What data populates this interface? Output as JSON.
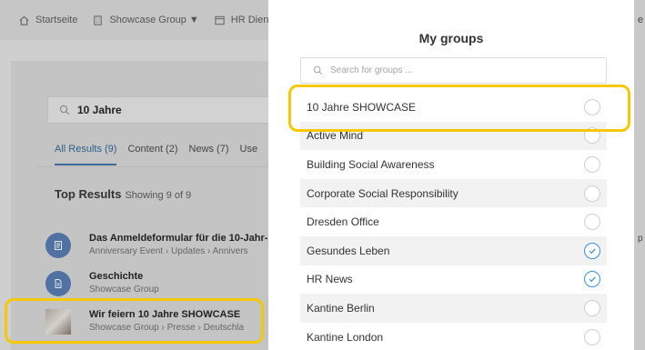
{
  "nav": {
    "home": "Startseite",
    "group": "Showcase Group ▼",
    "hr": "HR Dien",
    "right_edge": "e"
  },
  "search": {
    "query": "10 Jahre"
  },
  "tabs": [
    {
      "label": "All Results (9)"
    },
    {
      "label": "Content (2)"
    },
    {
      "label": "News (7)"
    },
    {
      "label": "Use"
    }
  ],
  "top_results": {
    "title": "Top Results",
    "subtitle": "Showing 9 of 9"
  },
  "results": [
    {
      "title": "Das Anmeldeformular für die 10-Jahr-F",
      "meta": "Anniversary Event  ›  Updates  ›  Annivers"
    },
    {
      "title": "Geschichte",
      "meta": "Showcase Group"
    },
    {
      "title": "Wir feiern 10 Jahre SHOWCASE",
      "meta": "Showcase Group  ›  Presse  ›  Deutschla"
    }
  ],
  "modal": {
    "title": "My groups",
    "search_placeholder": "Search for groups ...",
    "groups": [
      {
        "label": "10 Jahre SHOWCASE",
        "checked": false
      },
      {
        "label": "Active Mind",
        "checked": false
      },
      {
        "label": "Building Social Awareness",
        "checked": false
      },
      {
        "label": "Corporate Social Responsibility",
        "checked": false
      },
      {
        "label": "Dresden Office",
        "checked": false
      },
      {
        "label": "Gesundes Leben",
        "checked": true
      },
      {
        "label": "HR News",
        "checked": true
      },
      {
        "label": "Kantine Berlin",
        "checked": false
      },
      {
        "label": "Kantine London",
        "checked": false
      }
    ]
  },
  "right_strip": {
    "glyph": "p"
  },
  "colors": {
    "highlight": "#f5c800",
    "accent": "#3a8ed8",
    "brand": "#4f72a3"
  }
}
